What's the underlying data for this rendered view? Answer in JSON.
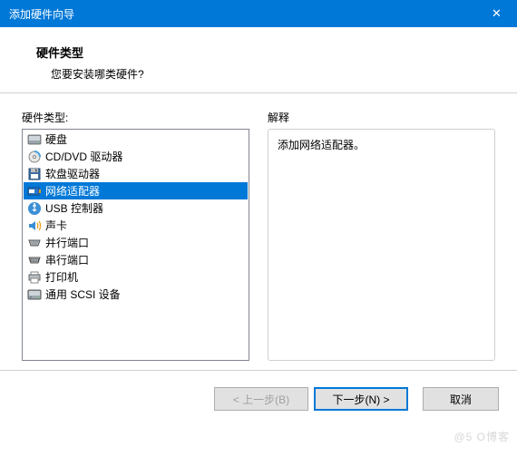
{
  "titlebar": {
    "title": "添加硬件向导"
  },
  "header": {
    "title": "硬件类型",
    "subtitle": "您要安装哪类硬件?"
  },
  "leftPanel": {
    "label": "硬件类型:"
  },
  "hardwareList": [
    {
      "label": "硬盘",
      "icon": "hard-disk-icon",
      "selected": false
    },
    {
      "label": "CD/DVD 驱动器",
      "icon": "cd-drive-icon",
      "selected": false
    },
    {
      "label": "软盘驱动器",
      "icon": "floppy-drive-icon",
      "selected": false
    },
    {
      "label": "网络适配器",
      "icon": "network-adapter-icon",
      "selected": true
    },
    {
      "label": "USB 控制器",
      "icon": "usb-controller-icon",
      "selected": false
    },
    {
      "label": "声卡",
      "icon": "sound-card-icon",
      "selected": false
    },
    {
      "label": "并行端口",
      "icon": "parallel-port-icon",
      "selected": false
    },
    {
      "label": "串行端口",
      "icon": "serial-port-icon",
      "selected": false
    },
    {
      "label": "打印机",
      "icon": "printer-icon",
      "selected": false
    },
    {
      "label": "通用 SCSI 设备",
      "icon": "scsi-device-icon",
      "selected": false
    }
  ],
  "rightPanel": {
    "label": "解释",
    "description": "添加网络适配器。"
  },
  "footer": {
    "back": "< 上一步(B)",
    "next": "下一步(N) >",
    "cancel": "取消"
  },
  "watermark": "@5     O博客"
}
